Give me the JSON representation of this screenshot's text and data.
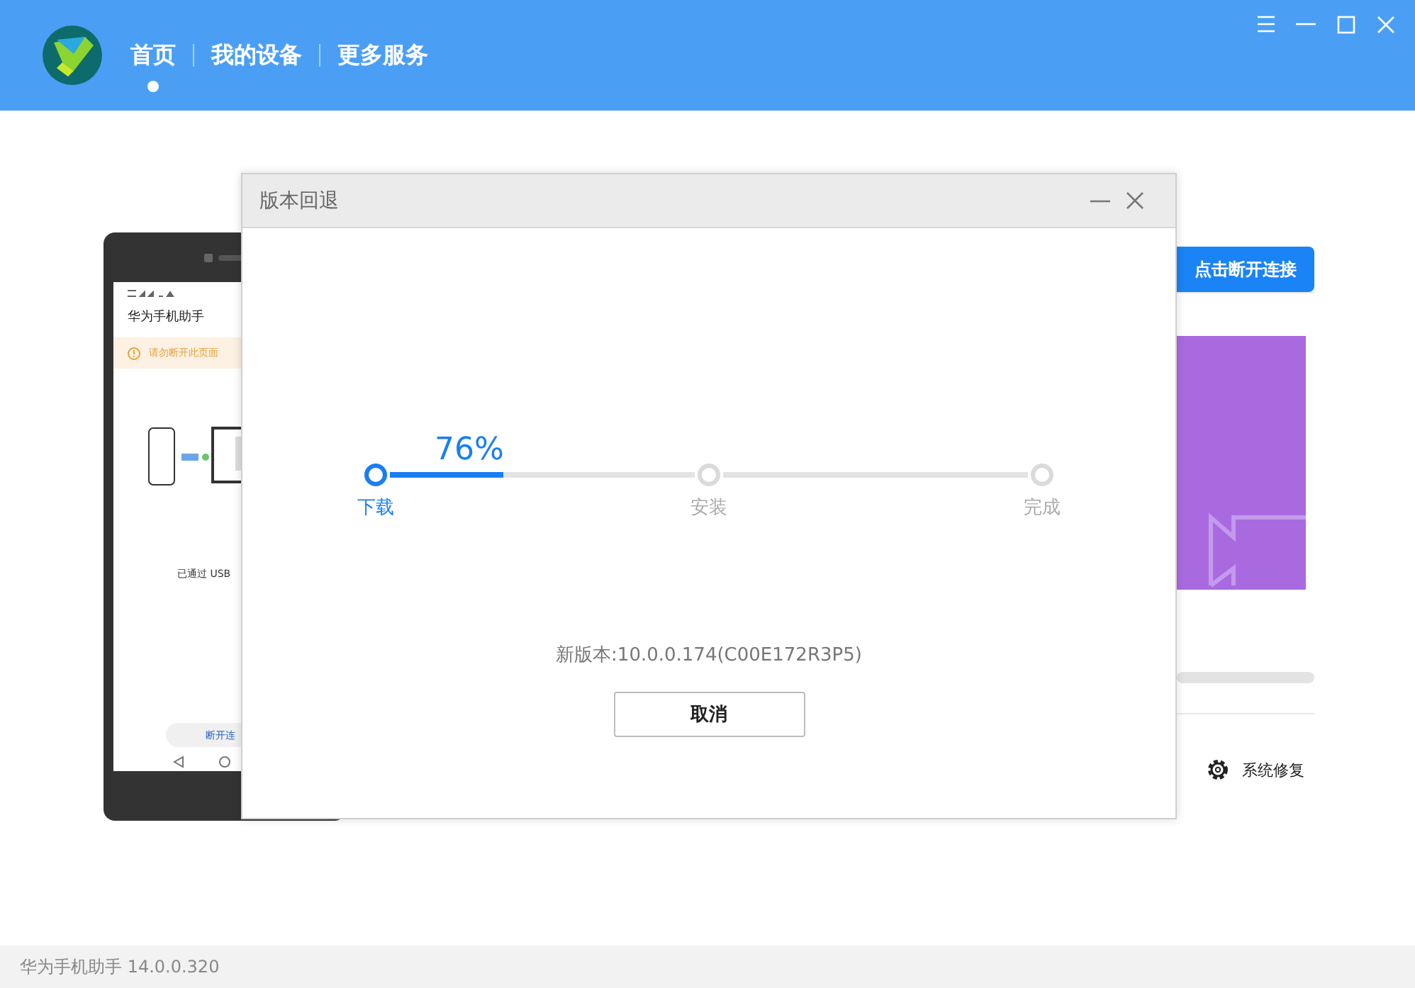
{
  "header": {
    "nav": [
      {
        "label": "首页",
        "selected": true
      },
      {
        "label": "我的设备",
        "selected": false
      },
      {
        "label": "更多服务",
        "selected": false
      }
    ]
  },
  "phone": {
    "app_title": "华为手机助手",
    "warning": "请勿断开此页面",
    "status": "已通过 USB",
    "button": "断开连"
  },
  "device_panel": {
    "disconnect_button": "点击断开连接",
    "repair_label": "系统修复"
  },
  "dialog": {
    "title": "版本回退",
    "percent": "76%",
    "level": 0.37,
    "steps": [
      {
        "label": "下载",
        "selected": true
      },
      {
        "label": "安装",
        "selected": false
      },
      {
        "label": "完成",
        "selected": false
      }
    ],
    "version": "新版本:10.0.0.174(C00E172R3P5)",
    "cancel_button": "取消"
  },
  "status_bar": {
    "text": "华为手机助手 14.0.0.320"
  }
}
